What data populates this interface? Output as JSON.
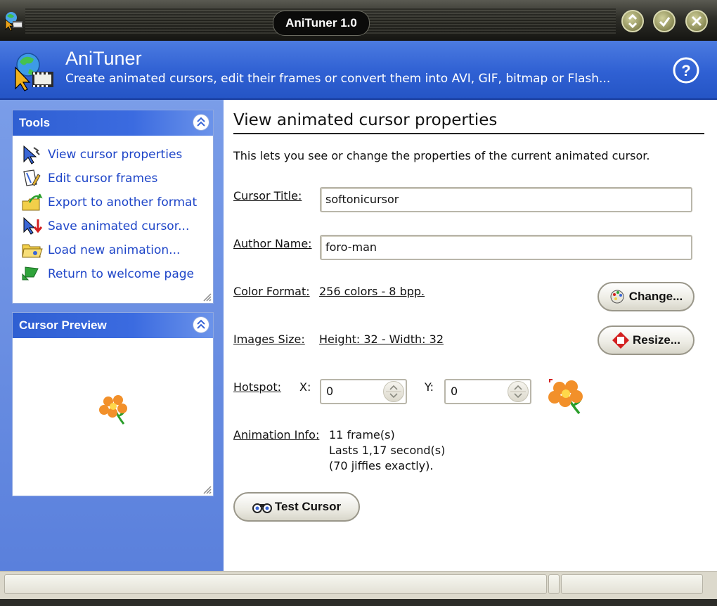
{
  "window": {
    "title": "AniTuner 1.0"
  },
  "header": {
    "app_name": "AniTuner",
    "subtitle": "Create animated cursors, edit their frames or convert them into AVI, GIF, bitmap or Flash...",
    "help_icon": "help-circle-icon"
  },
  "tools": {
    "heading": "Tools",
    "items": [
      {
        "label": "View cursor properties",
        "icon": "cursor-properties-icon"
      },
      {
        "label": "Edit cursor frames",
        "icon": "edit-frames-icon"
      },
      {
        "label": "Export to another format",
        "icon": "export-icon"
      },
      {
        "label": "Save animated cursor...",
        "icon": "save-cursor-icon"
      },
      {
        "label": "Load new animation...",
        "icon": "load-folder-icon"
      },
      {
        "label": "Return to welcome page",
        "icon": "return-arrow-icon"
      }
    ]
  },
  "preview": {
    "heading": "Cursor Preview",
    "image": "flower-icon"
  },
  "main": {
    "title": "View animated cursor properties",
    "description": "This lets you see or change the properties of the current animated cursor.",
    "cursor_title_label": "Cursor Title:",
    "cursor_title_value": "softonicursor",
    "author_label": "Author Name:",
    "author_value": "foro-man",
    "color_format_label": "Color Format:",
    "color_format_value": "256 colors - 8 bpp.",
    "change_button": "Change...",
    "images_size_label": "Images Size:",
    "images_size_value": "Height: 32 - Width: 32",
    "resize_button": "Resize...",
    "hotspot_label": "Hotspot:",
    "hotspot_x_label": "X:",
    "hotspot_x_value": "0",
    "hotspot_y_label": "Y:",
    "hotspot_y_value": "0",
    "animation_label": "Animation Info:",
    "animation_lines": [
      "11 frame(s)",
      "Lasts 1,17 second(s)",
      "(70 jiffies exactly)."
    ],
    "test_button": "Test Cursor"
  },
  "colors": {
    "header_blue": "#2f60d3",
    "panel_blue": "#5a80dc",
    "link_blue": "#1e45c8",
    "titlebar_dark": "#1c1c18"
  }
}
